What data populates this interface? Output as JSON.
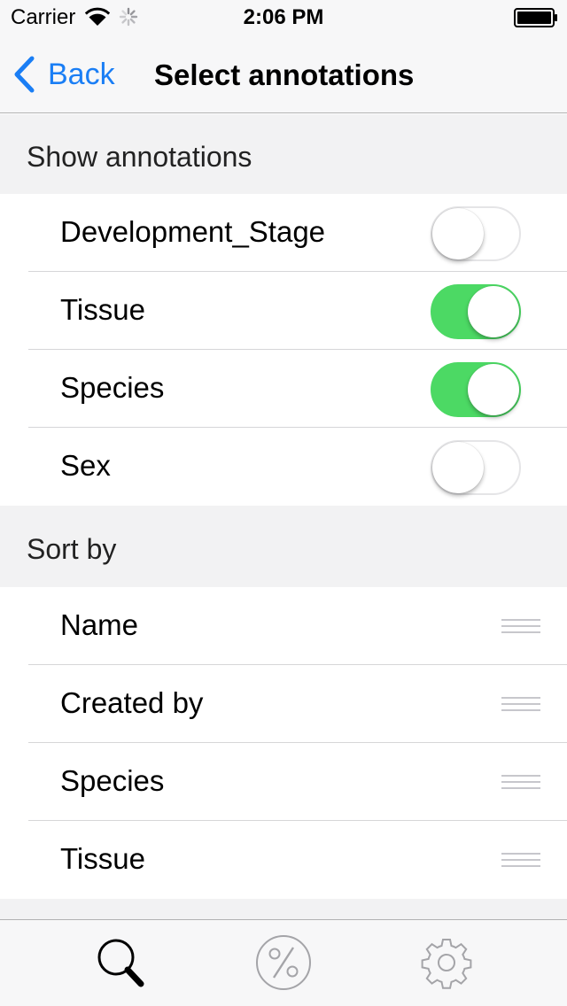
{
  "status_bar": {
    "carrier": "Carrier",
    "time": "2:06 PM",
    "icons": [
      "wifi-icon",
      "activity-spinner-icon",
      "battery-icon"
    ]
  },
  "nav_bar": {
    "back_label": "Back",
    "title": "Select annotations",
    "accent_color": "#1a7ef5"
  },
  "sections": {
    "show_annotations": {
      "header": "Show annotations",
      "items": [
        {
          "label": "Development_Stage",
          "enabled": false
        },
        {
          "label": "Tissue",
          "enabled": true
        },
        {
          "label": "Species",
          "enabled": true
        },
        {
          "label": "Sex",
          "enabled": false
        }
      ]
    },
    "sort_by": {
      "header": "Sort by",
      "items": [
        {
          "label": "Name"
        },
        {
          "label": "Created by"
        },
        {
          "label": "Species"
        },
        {
          "label": "Tissue"
        }
      ]
    }
  },
  "tab_bar": {
    "items": [
      {
        "icon": "search-icon",
        "selected": true
      },
      {
        "icon": "percent-icon",
        "selected": false
      },
      {
        "icon": "gear-icon",
        "selected": false
      }
    ]
  },
  "colors": {
    "toggle_on": "#4cd964",
    "section_background": "#f2f2f3",
    "grip": "#c7c7cc"
  }
}
